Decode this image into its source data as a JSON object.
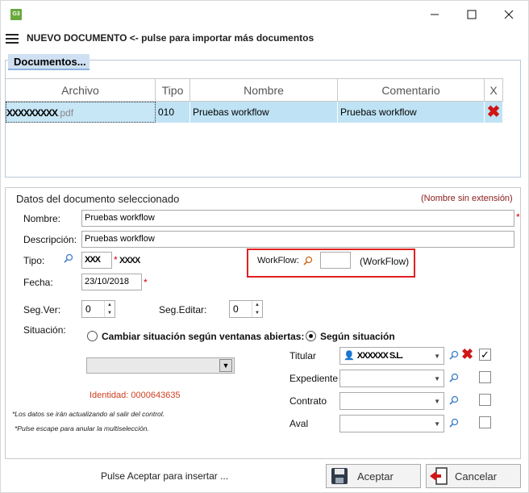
{
  "app": {
    "icon_label": "G3"
  },
  "header": {
    "title": "NUEVO DOCUMENTO <- pulse para importar más documentos"
  },
  "documents": {
    "title": "Documentos...",
    "columns": [
      "Archivo",
      "Tipo",
      "Nombre",
      "Comentario",
      "X"
    ],
    "rows": [
      {
        "archivo_name": "XXXXXXXXX",
        "archivo_ext": ".pdf",
        "tipo": "010",
        "nombre": "Pruebas workflow",
        "comentario": "Pruebas workflow"
      }
    ]
  },
  "details": {
    "title": "Datos del documento seleccionado",
    "hint": "(Nombre sin extensión)",
    "nombre_label": "Nombre:",
    "nombre_value": "Pruebas workflow",
    "descripcion_label": "Descripción:",
    "descripcion_value": "Pruebas workflow",
    "tipo_label": "Tipo:",
    "tipo_code": "XXX",
    "tipo_desc": "XXXX",
    "workflow_label": "WorkFlow:",
    "workflow_value": "",
    "workflow_desc": "(WorkFlow)",
    "fecha_label": "Fecha:",
    "fecha_value": "23/10/2018",
    "segver_label": "Seg.Ver:",
    "segver_value": "0",
    "segeditar_label": "Seg.Editar:",
    "segeditar_value": "0",
    "situacion_label": "Situación:",
    "radio_ventanas": "Cambiar situación según ventanas abiertas:",
    "radio_situacion": "Según situación",
    "titular_label": "Titular",
    "titular_value": "XXXXXX S.L.",
    "expediente_label": "Expediente",
    "contrato_label": "Contrato",
    "aval_label": "Aval",
    "identidad": "Identidad: 0000643635",
    "note1": "*Los datos se irán actualizando  al salir del control.",
    "note2": "*Pulse escape para anular la multiselección."
  },
  "footer": {
    "hint": "Pulse Aceptar para insertar ...",
    "accept_label": "Aceptar",
    "cancel_label": "Cancelar"
  },
  "colors": {
    "selection_row": "#bfe3f4",
    "accent_red": "#d01515",
    "panel_title_bg": "#cfe0f2"
  }
}
